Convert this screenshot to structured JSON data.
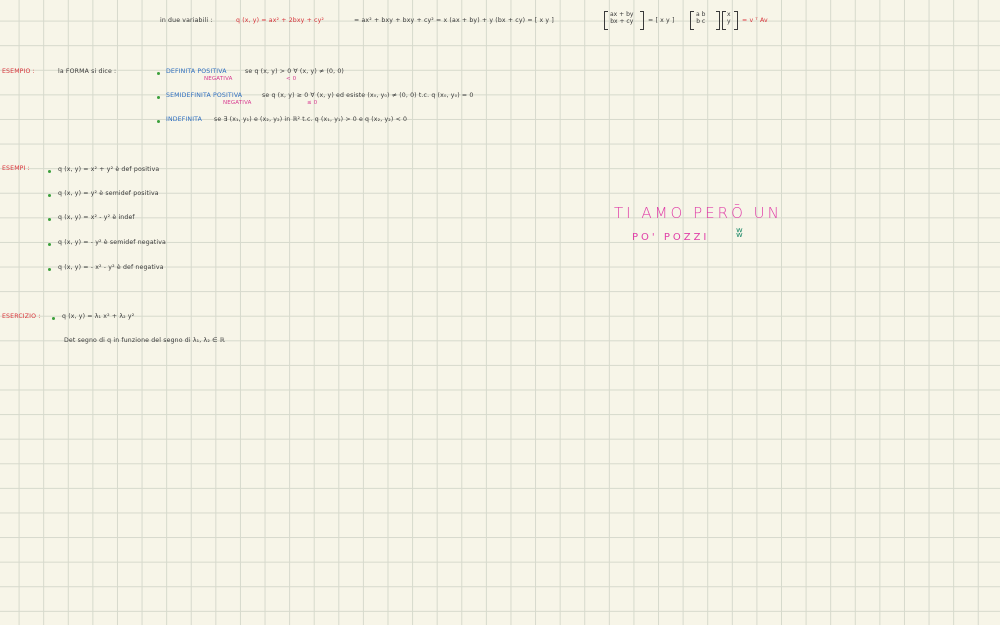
{
  "header": {
    "prefix": "in due variabili :",
    "q_def": "q (x, y)  = ax² + 2bxy + cy²",
    "expansion": "=  ax² + bxy + bxy + cy²  =  x (ax + by) + y (bx + cy)  =  [ x   y ]",
    "vec_top": "ax + by",
    "vec_bottom": "bx + cy",
    "eq_after_vec": "= [ x   y ]",
    "mat_top": "a   b",
    "mat_bottom": "b   c",
    "col_top": "x",
    "col_bottom": "y",
    "result": "= v ᵀ Av"
  },
  "esempio": {
    "label": "ESEMPIO :",
    "intro": "la   FORMA   si  dice :",
    "items": [
      {
        "term": "DEFINITA  POSITIVA",
        "sub": "NEGATIVA",
        "cond": "se  q (x, y) > 0    ∀ (x, y) ≠ (0, 0)",
        "cond_sub": "< 0"
      },
      {
        "term": "SEMIDEFINITA  POSITIVA",
        "sub": "NEGATIVA",
        "cond": "se  q (x, y) ≥ 0    ∀ (x, y)    ed esiste  (x₀, y₀) ≠ (0, 0)   t.c.   q (x₀, y₀) = 0",
        "cond_sub": "≤ 0"
      },
      {
        "term": "INDEFINITA",
        "cond": "se  ∃  (x₁, y₁)  e  (x₂, y₂)   in ℝ²   t.c.   q (x₁, y₁) > 0      e  q (x₂, y₂) < 0"
      }
    ]
  },
  "esempi": {
    "label": "ESEMPI :",
    "items": [
      "q (x, y) =  x² + y²      è  def  positiva",
      "q (x, y) =  y²      è  semidef  positiva",
      "q (x, y) = x² - y²      è  indef",
      "q (x, y) = - y²      è  semidef  negativa",
      "q (x, y)   = - x² - y²      è   def  negativa"
    ]
  },
  "esercizio": {
    "label": "ESERCIZIO :",
    "formula": "q (x, y)  =  λ₁ x²  +  λ₂ y²",
    "task": "Det  segno  di  q   in  funzione  del  segno  di  λ₁, λ₂ ∈ ℝ"
  },
  "note": {
    "line1": "TI  AMO  PERŌ  UN",
    "line2": "PO'  POZZI",
    "doodle": "ʬ"
  }
}
